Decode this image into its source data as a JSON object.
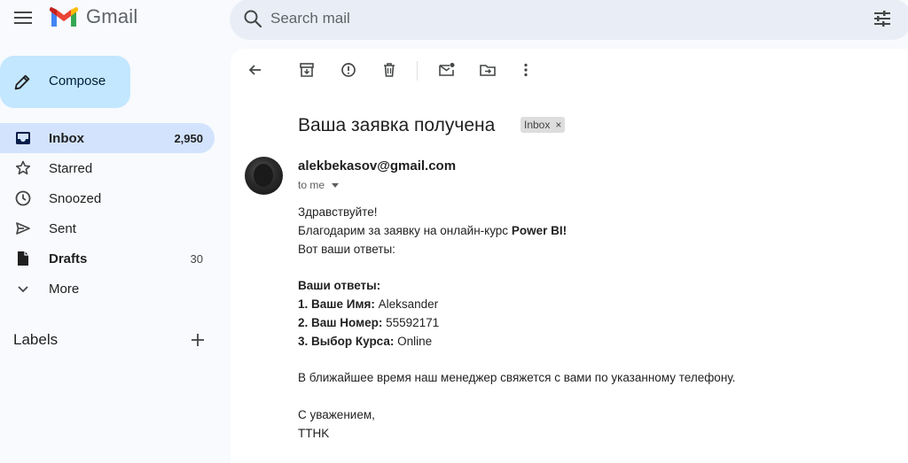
{
  "app": {
    "name": "Gmail",
    "icon": "gmail-logo"
  },
  "search": {
    "placeholder": "Search mail"
  },
  "compose": {
    "label": "Compose"
  },
  "nav": [
    {
      "id": "inbox",
      "label": "Inbox",
      "count": "2,950",
      "icon": "inbox-icon",
      "active": true,
      "bold": true
    },
    {
      "id": "starred",
      "label": "Starred",
      "count": "",
      "icon": "star-icon"
    },
    {
      "id": "snoozed",
      "label": "Snoozed",
      "count": "",
      "icon": "clock-icon"
    },
    {
      "id": "sent",
      "label": "Sent",
      "count": "",
      "icon": "send-icon"
    },
    {
      "id": "drafts",
      "label": "Drafts",
      "count": "30",
      "icon": "draft-icon",
      "bold": true
    },
    {
      "id": "more",
      "label": "More",
      "count": "",
      "icon": "chevron-down-icon"
    }
  ],
  "labels": {
    "title": "Labels"
  },
  "message": {
    "subject": "Ваша заявка получена",
    "chip": "Inbox",
    "chip_close": "×",
    "sender": "alekbekasov@gmail.com",
    "to": "to me",
    "greeting": "Здравствуйте!",
    "thanks_prefix": "Благодарим за заявку на онлайн-курс ",
    "course": "Power BI!",
    "answers_intro": "Вот ваши ответы:",
    "answers_title": "Ваши ответы:",
    "answers": [
      {
        "label": "1. Ваше Имя:",
        "value": "Aleksander"
      },
      {
        "label": "2. Ваш Номер:",
        "value": "55592171"
      },
      {
        "label": "3. Выбор Курса:",
        "value": "Online"
      }
    ],
    "followup": "В ближайшее время наш менеджер свяжется с вами по указанному телефону.",
    "closing": "С уважением,",
    "signature": "TTHK"
  },
  "colors": {
    "background": "#f8fafd",
    "search_bg": "#e9eef6",
    "compose_bg": "#c2e7ff",
    "nav_active": "#d3e3fd"
  }
}
